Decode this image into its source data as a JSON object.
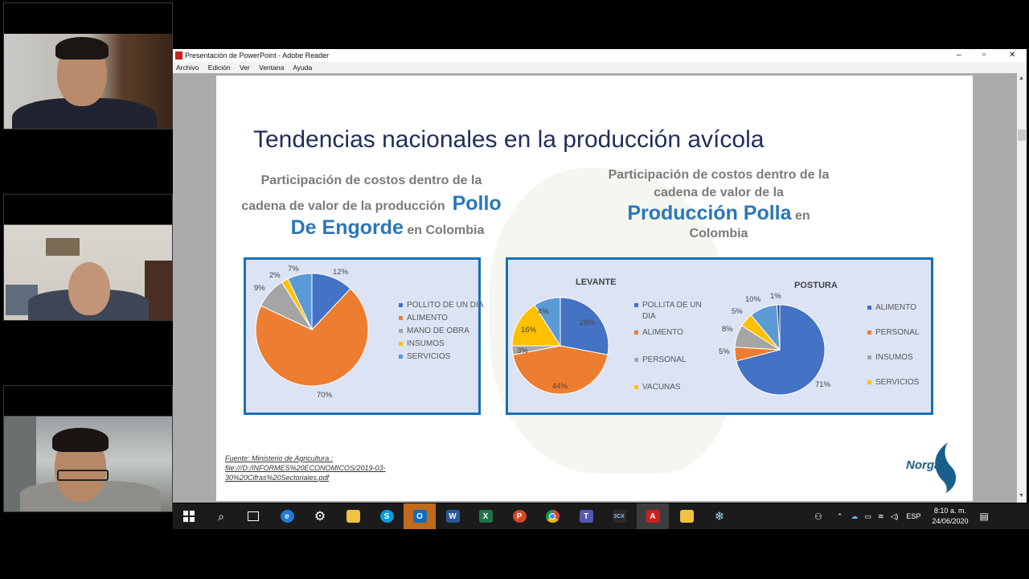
{
  "window": {
    "title": "Presentación de PowerPoint - Adobe Reader",
    "menu": [
      "Archivo",
      "Edición",
      "Ver",
      "Ventana",
      "Ayuda"
    ],
    "controls": {
      "minimize": "–",
      "maximize": "▫",
      "close": "✕"
    }
  },
  "slide": {
    "title": "Tendencias nacionales en la producción avícola",
    "left_heading": {
      "line1": "Participación de costos dentro de la",
      "line2_prefix": "cadena de valor de la producción",
      "highlight1": "Pollo",
      "highlight2": "De Engorde",
      "suffix": "en Colombia"
    },
    "right_heading": {
      "line1": "Participación de costos dentro de la",
      "line2": "cadena de valor de la",
      "highlight": "Producción Polla",
      "suffix1": "en",
      "suffix2": "Colombia"
    },
    "source": {
      "line1": "Fuente: Ministerio de Agricultura :",
      "line2": "file:///D:/INFORMES%20ECONOMICOS/2019-03-",
      "line3": "30%20Cifras%20Sectoriales.pdf"
    },
    "logo_text": "Norgas"
  },
  "chart_data": [
    {
      "type": "pie",
      "title": "",
      "categories": [
        "POLLITO DE UN DIA",
        "ALIMENTO",
        "MANO DE OBRA",
        "INSUMOS",
        "SERVICIOS"
      ],
      "values": [
        12,
        70,
        9,
        2,
        7
      ],
      "labels": [
        "12%",
        "70%",
        "9%",
        "2%",
        "7%"
      ],
      "colors": [
        "#4472c4",
        "#ed7d31",
        "#a5a5a5",
        "#ffc000",
        "#5b9bd5"
      ],
      "legend": "right"
    },
    {
      "type": "pie",
      "title": "LEVANTE",
      "categories": [
        "POLLITA DE UN DIA",
        "ALIMENTO",
        "PERSONAL",
        "VACUNAS"
      ],
      "legend_lines": [
        "POLLITA DE UN",
        "DIA"
      ],
      "values": [
        28,
        44,
        3,
        16,
        9
      ],
      "labels": [
        "28%",
        "44%",
        "3%",
        "16%",
        "4%"
      ],
      "colors": [
        "#4472c4",
        "#ed7d31",
        "#a5a5a5",
        "#ffc000",
        "#5b9bd5"
      ],
      "legend": "right"
    },
    {
      "type": "pie",
      "title": "POSTURA",
      "categories": [
        "ALIMENTO",
        "PERSONAL",
        "INSUMOS",
        "SERVICIOS"
      ],
      "values": [
        71,
        5,
        8,
        5,
        10,
        1
      ],
      "labels": [
        "71%",
        "5%",
        "8%",
        "5%",
        "10%",
        "1%"
      ],
      "colors": [
        "#4472c4",
        "#ed7d31",
        "#a5a5a5",
        "#ffc000",
        "#5b9bd5",
        "#264478"
      ],
      "legend": "right"
    }
  ],
  "taskbar": {
    "apps": [
      "start",
      "search",
      "task-view",
      "edge",
      "settings",
      "file-explorer",
      "skype",
      "outlook",
      "word",
      "excel",
      "powerpoint",
      "chrome",
      "teams",
      "3cx",
      "adobe-reader",
      "folder",
      "snowflake-app"
    ],
    "labels": {
      "word": "W",
      "excel": "X",
      "powerpoint": "P",
      "outlook": "O",
      "3cx": "3CX"
    },
    "language": "ESP",
    "time": "8:10 a. m.",
    "date": "24/06/2020"
  }
}
